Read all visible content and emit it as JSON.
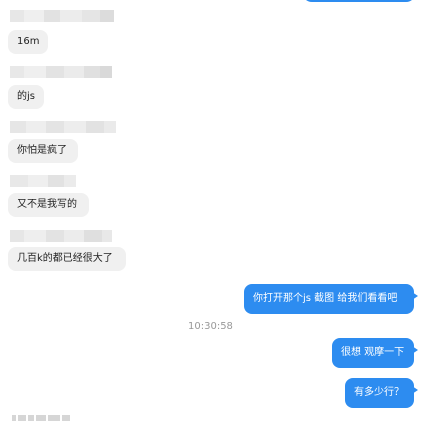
{
  "messages": [
    {
      "side": "left",
      "text": "16m"
    },
    {
      "side": "left",
      "text": "的js"
    },
    {
      "side": "left",
      "text": "你怕是疯了"
    },
    {
      "side": "left",
      "text": "又不是我写的"
    },
    {
      "side": "left",
      "text": "几百k的都已经很大了"
    },
    {
      "side": "right",
      "text": "你打开那个js 截图 给我们看看吧"
    },
    {
      "side": "right",
      "text": "很想 观摩一下"
    },
    {
      "side": "right",
      "text": "有多少行？"
    }
  ],
  "timestamp": "10:30:58",
  "colors": {
    "sent_bubble": "#2d8cf0",
    "received_bubble": "#f0f0f0",
    "timestamp_text": "#999999"
  }
}
